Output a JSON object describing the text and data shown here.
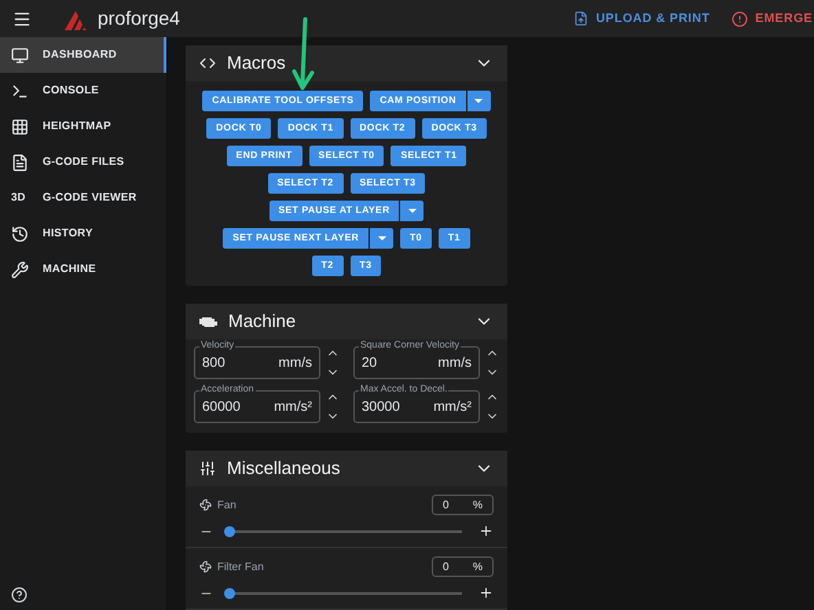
{
  "app": {
    "title": "proforge4"
  },
  "toolbar": {
    "upload": "UPLOAD & PRINT",
    "emergency": "EMERGE"
  },
  "sidebar": {
    "items": [
      {
        "label": "DASHBOARD",
        "selected": true
      },
      {
        "label": "CONSOLE",
        "selected": false
      },
      {
        "label": "HEIGHTMAP",
        "selected": false
      },
      {
        "label": "G-CODE FILES",
        "selected": false
      },
      {
        "label": "G-CODE VIEWER",
        "selected": false,
        "badge": "3D"
      },
      {
        "label": "HISTORY",
        "selected": false
      },
      {
        "label": "MACHINE",
        "selected": false
      }
    ]
  },
  "macros": {
    "title": "Macros",
    "expanded": true,
    "rows": [
      [
        {
          "label": "CALIBRATE TOOL OFFSETS",
          "dropdown": false
        },
        {
          "label": "CAM POSITION",
          "dropdown": true
        }
      ],
      [
        {
          "label": "DOCK T0",
          "dropdown": false
        },
        {
          "label": "DOCK T1",
          "dropdown": false
        },
        {
          "label": "DOCK T2",
          "dropdown": false
        },
        {
          "label": "DOCK T3",
          "dropdown": false
        }
      ],
      [
        {
          "label": "END PRINT",
          "dropdown": false
        },
        {
          "label": "SELECT T0",
          "dropdown": false
        },
        {
          "label": "SELECT T1",
          "dropdown": false
        }
      ],
      [
        {
          "label": "SELECT T2",
          "dropdown": false
        },
        {
          "label": "SELECT T3",
          "dropdown": false
        }
      ],
      [
        {
          "label": "SET PAUSE AT LAYER",
          "dropdown": true
        }
      ],
      [
        {
          "label": "SET PAUSE NEXT LAYER",
          "dropdown": true
        },
        {
          "label": "T0",
          "dropdown": false
        },
        {
          "label": "T1",
          "dropdown": false
        }
      ],
      [
        {
          "label": "T2",
          "dropdown": false
        },
        {
          "label": "T3",
          "dropdown": false
        }
      ]
    ]
  },
  "machine": {
    "title": "Machine",
    "expanded": true,
    "fields": [
      {
        "label": "Velocity",
        "value": "800",
        "unit": "mm/s"
      },
      {
        "label": "Square Corner Velocity",
        "value": "20",
        "unit": "mm/s"
      },
      {
        "label": "Acceleration",
        "value": "60000",
        "unit": "mm/s²"
      },
      {
        "label": "Max Accel. to Decel.",
        "value": "30000",
        "unit": "mm/s²"
      }
    ]
  },
  "miscellaneous": {
    "title": "Miscellaneous",
    "expanded": true,
    "fans": [
      {
        "label": "Fan",
        "value": "0",
        "unit": "%",
        "level": 0
      },
      {
        "label": "Filter Fan",
        "value": "0",
        "unit": "%",
        "level": 0
      }
    ]
  }
}
